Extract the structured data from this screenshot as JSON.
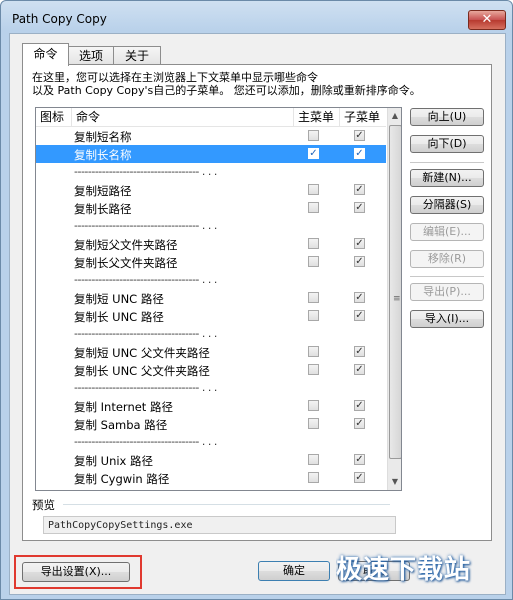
{
  "window": {
    "title": "Path Copy Copy",
    "close_glyph": "✕"
  },
  "tabs": [
    {
      "label": "命令",
      "active": true
    },
    {
      "label": "选项",
      "active": false
    },
    {
      "label": "关于",
      "active": false
    }
  ],
  "description": "在这里，您可以选择在主浏览器上下文菜单中显示哪些命令\n以及 Path Copy Copy's自己的子菜单。 您还可以添加，删除或重新排序命令。",
  "list": {
    "headers": {
      "icon": "图标",
      "command": "命令",
      "main_menu": "主菜单",
      "sub_menu": "子菜单"
    },
    "rows": [
      {
        "type": "item",
        "name": "复制短名称",
        "main": false,
        "sub": true
      },
      {
        "type": "item",
        "name": "复制长名称",
        "main": true,
        "sub": true,
        "selected": true
      },
      {
        "type": "sep",
        "text": "------------------------------------ . . ."
      },
      {
        "type": "item",
        "name": "复制短路径",
        "main": false,
        "sub": true
      },
      {
        "type": "item",
        "name": "复制长路径",
        "main": false,
        "sub": true
      },
      {
        "type": "sep",
        "text": "------------------------------------ . . ."
      },
      {
        "type": "item",
        "name": "复制短父文件夹路径",
        "main": false,
        "sub": true
      },
      {
        "type": "item",
        "name": "复制长父文件夹路径",
        "main": false,
        "sub": true
      },
      {
        "type": "sep",
        "text": "------------------------------------ . . ."
      },
      {
        "type": "item",
        "name": "复制短 UNC 路径",
        "main": false,
        "sub": true
      },
      {
        "type": "item",
        "name": "复制长 UNC 路径",
        "main": false,
        "sub": true
      },
      {
        "type": "sep",
        "text": "------------------------------------ . . ."
      },
      {
        "type": "item",
        "name": "复制短 UNC 父文件夹路径",
        "main": false,
        "sub": true
      },
      {
        "type": "item",
        "name": "复制长 UNC 父文件夹路径",
        "main": false,
        "sub": true
      },
      {
        "type": "sep",
        "text": "------------------------------------ . . ."
      },
      {
        "type": "item",
        "name": "复制 Internet 路径",
        "main": false,
        "sub": true
      },
      {
        "type": "item",
        "name": "复制 Samba 路径",
        "main": false,
        "sub": true
      },
      {
        "type": "sep",
        "text": "------------------------------------ . . ."
      },
      {
        "type": "item",
        "name": "复制 Unix 路径",
        "main": false,
        "sub": true
      },
      {
        "type": "item",
        "name": "复制 Cygwin 路径",
        "main": false,
        "sub": true
      }
    ],
    "check_glyph": "✓"
  },
  "side_buttons": {
    "move_up": "向上(U)",
    "move_down": "向下(D)",
    "new": "新建(N)...",
    "separator": "分隔器(S)",
    "edit": "编辑(E)...",
    "remove": "移除(R)",
    "export": "导出(P)...",
    "import": "导入(I)..."
  },
  "preview": {
    "label": "预览",
    "value": "PathCopyCopySettings.exe"
  },
  "footer": {
    "export_settings": "导出设置(X)...",
    "ok": "确定",
    "cancel": "取消"
  },
  "watermark": "极速下载站",
  "colors": {
    "selection": "#3399ff",
    "highlight_outline": "#e0392f"
  }
}
